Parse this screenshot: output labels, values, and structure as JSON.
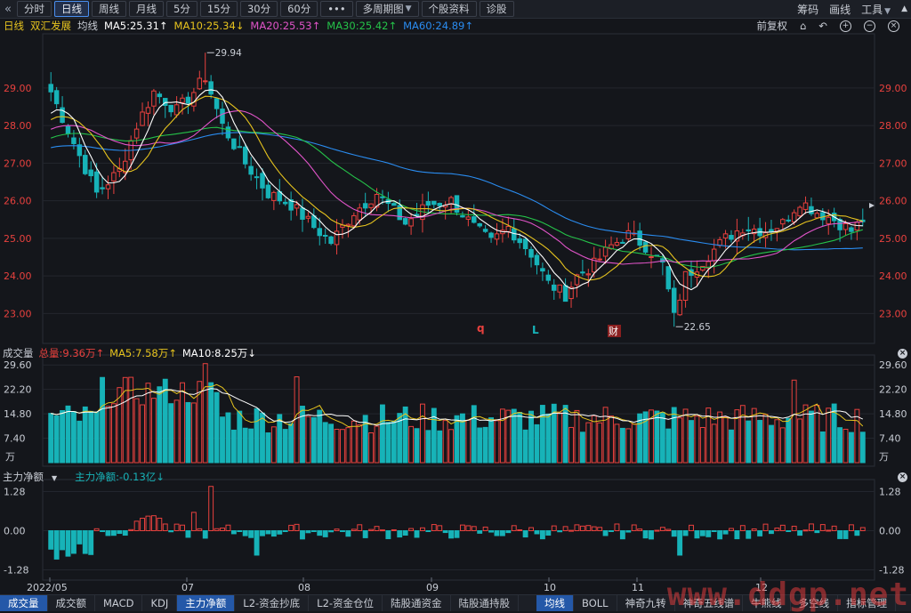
{
  "toolbar": {
    "back_icon": "double-chevron-left-icon",
    "tabs": [
      "分时",
      "日线",
      "周线",
      "月线",
      "5分",
      "15分",
      "30分",
      "60分",
      "•••",
      "多周期图",
      "个股资料",
      "诊股"
    ],
    "active_tab": "日线",
    "right": [
      "筹码",
      "画线",
      "工具"
    ],
    "dropdown_icon": "chevron-down-icon"
  },
  "info": {
    "period": "日线",
    "name": "双汇发展",
    "ma_label": "均线",
    "ma5": "MA5:25.31↑",
    "ma10": "MA10:25.34↓",
    "ma20": "MA20:25.53↑",
    "ma30": "MA30:25.42↑",
    "ma60": "MA60:24.89↑",
    "adjust": "前复权"
  },
  "volume_info": {
    "title": "成交量",
    "total": "总量:9.36万↑",
    "ma5": "MA5:7.58万↑",
    "ma10": "MA10:8.25万↓"
  },
  "flow_info": {
    "title": "主力净额",
    "value": "主力净额:-0.13亿↓"
  },
  "bottom_tabs": [
    "成交量",
    "成交额",
    "MACD",
    "KDJ",
    "主力净额",
    "L2-资金抄底",
    "L2-资金仓位",
    "陆股通资金",
    "陆股通持股",
    "均线",
    "BOLL",
    "神奇九转",
    "神奇五线谱",
    "牛熊线",
    "多空线",
    "指标管理"
  ],
  "bottom_active": [
    "成交量",
    "主力净额",
    "均线"
  ],
  "watermark": "www.ddgp.net",
  "colors": {
    "up": "#e8413e",
    "down": "#17b3b8",
    "ma5": "#ffffff",
    "ma10": "#e6c31e",
    "ma20": "#e054c8",
    "ma30": "#25c249",
    "ma60": "#2a8cf0",
    "background": "#14161b"
  },
  "chart_data": {
    "type": "candlestick",
    "price_axis": {
      "ticks": [
        29.0,
        28.0,
        27.0,
        26.0,
        25.0,
        24.0,
        23.0
      ],
      "range": [
        22.3,
        30.3
      ]
    },
    "annotations": {
      "high": "29.94",
      "low": "22.65",
      "event_labels": [
        "q",
        "L",
        "财"
      ]
    },
    "x_ticks": [
      "2022/05",
      "07",
      "08",
      "09",
      "10",
      "11",
      "12"
    ],
    "volume_axis": {
      "ticks": [
        "29.60",
        "22.20",
        "14.80",
        "7.40"
      ],
      "unit": "万",
      "range": [
        0,
        31
      ]
    },
    "flow_axis": {
      "ticks": [
        "1.28",
        "0.00",
        "-1.28"
      ],
      "range": [
        -1.5,
        1.5
      ]
    },
    "anchors": [
      [
        0,
        28.9
      ],
      [
        5,
        27.2
      ],
      [
        8,
        26.2
      ],
      [
        12,
        26.8
      ],
      [
        15,
        28.0
      ],
      [
        18,
        28.9
      ],
      [
        22,
        28.4
      ],
      [
        25,
        28.9
      ],
      [
        27,
        29.3
      ],
      [
        30,
        28.0
      ],
      [
        34,
        27.0
      ],
      [
        38,
        26.2
      ],
      [
        42,
        25.9
      ],
      [
        46,
        25.3
      ],
      [
        49,
        24.9
      ],
      [
        53,
        25.7
      ],
      [
        57,
        26.2
      ],
      [
        62,
        25.4
      ],
      [
        66,
        25.9
      ],
      [
        70,
        26.0
      ],
      [
        74,
        25.3
      ],
      [
        77,
        24.9
      ],
      [
        80,
        25.3
      ],
      [
        84,
        24.6
      ],
      [
        87,
        23.8
      ],
      [
        90,
        23.5
      ],
      [
        92,
        24.0
      ],
      [
        95,
        24.3
      ],
      [
        98,
        24.8
      ],
      [
        101,
        25.1
      ],
      [
        104,
        24.8
      ],
      [
        107,
        24.3
      ],
      [
        109,
        22.9
      ],
      [
        111,
        24.0
      ],
      [
        114,
        24.4
      ],
      [
        118,
        25.0
      ],
      [
        121,
        25.3
      ],
      [
        125,
        25.2
      ],
      [
        128,
        25.4
      ],
      [
        131,
        26.0
      ],
      [
        134,
        25.7
      ],
      [
        137,
        25.5
      ],
      [
        140,
        25.2
      ],
      [
        142,
        25.5
      ]
    ],
    "dates_count": 143
  }
}
